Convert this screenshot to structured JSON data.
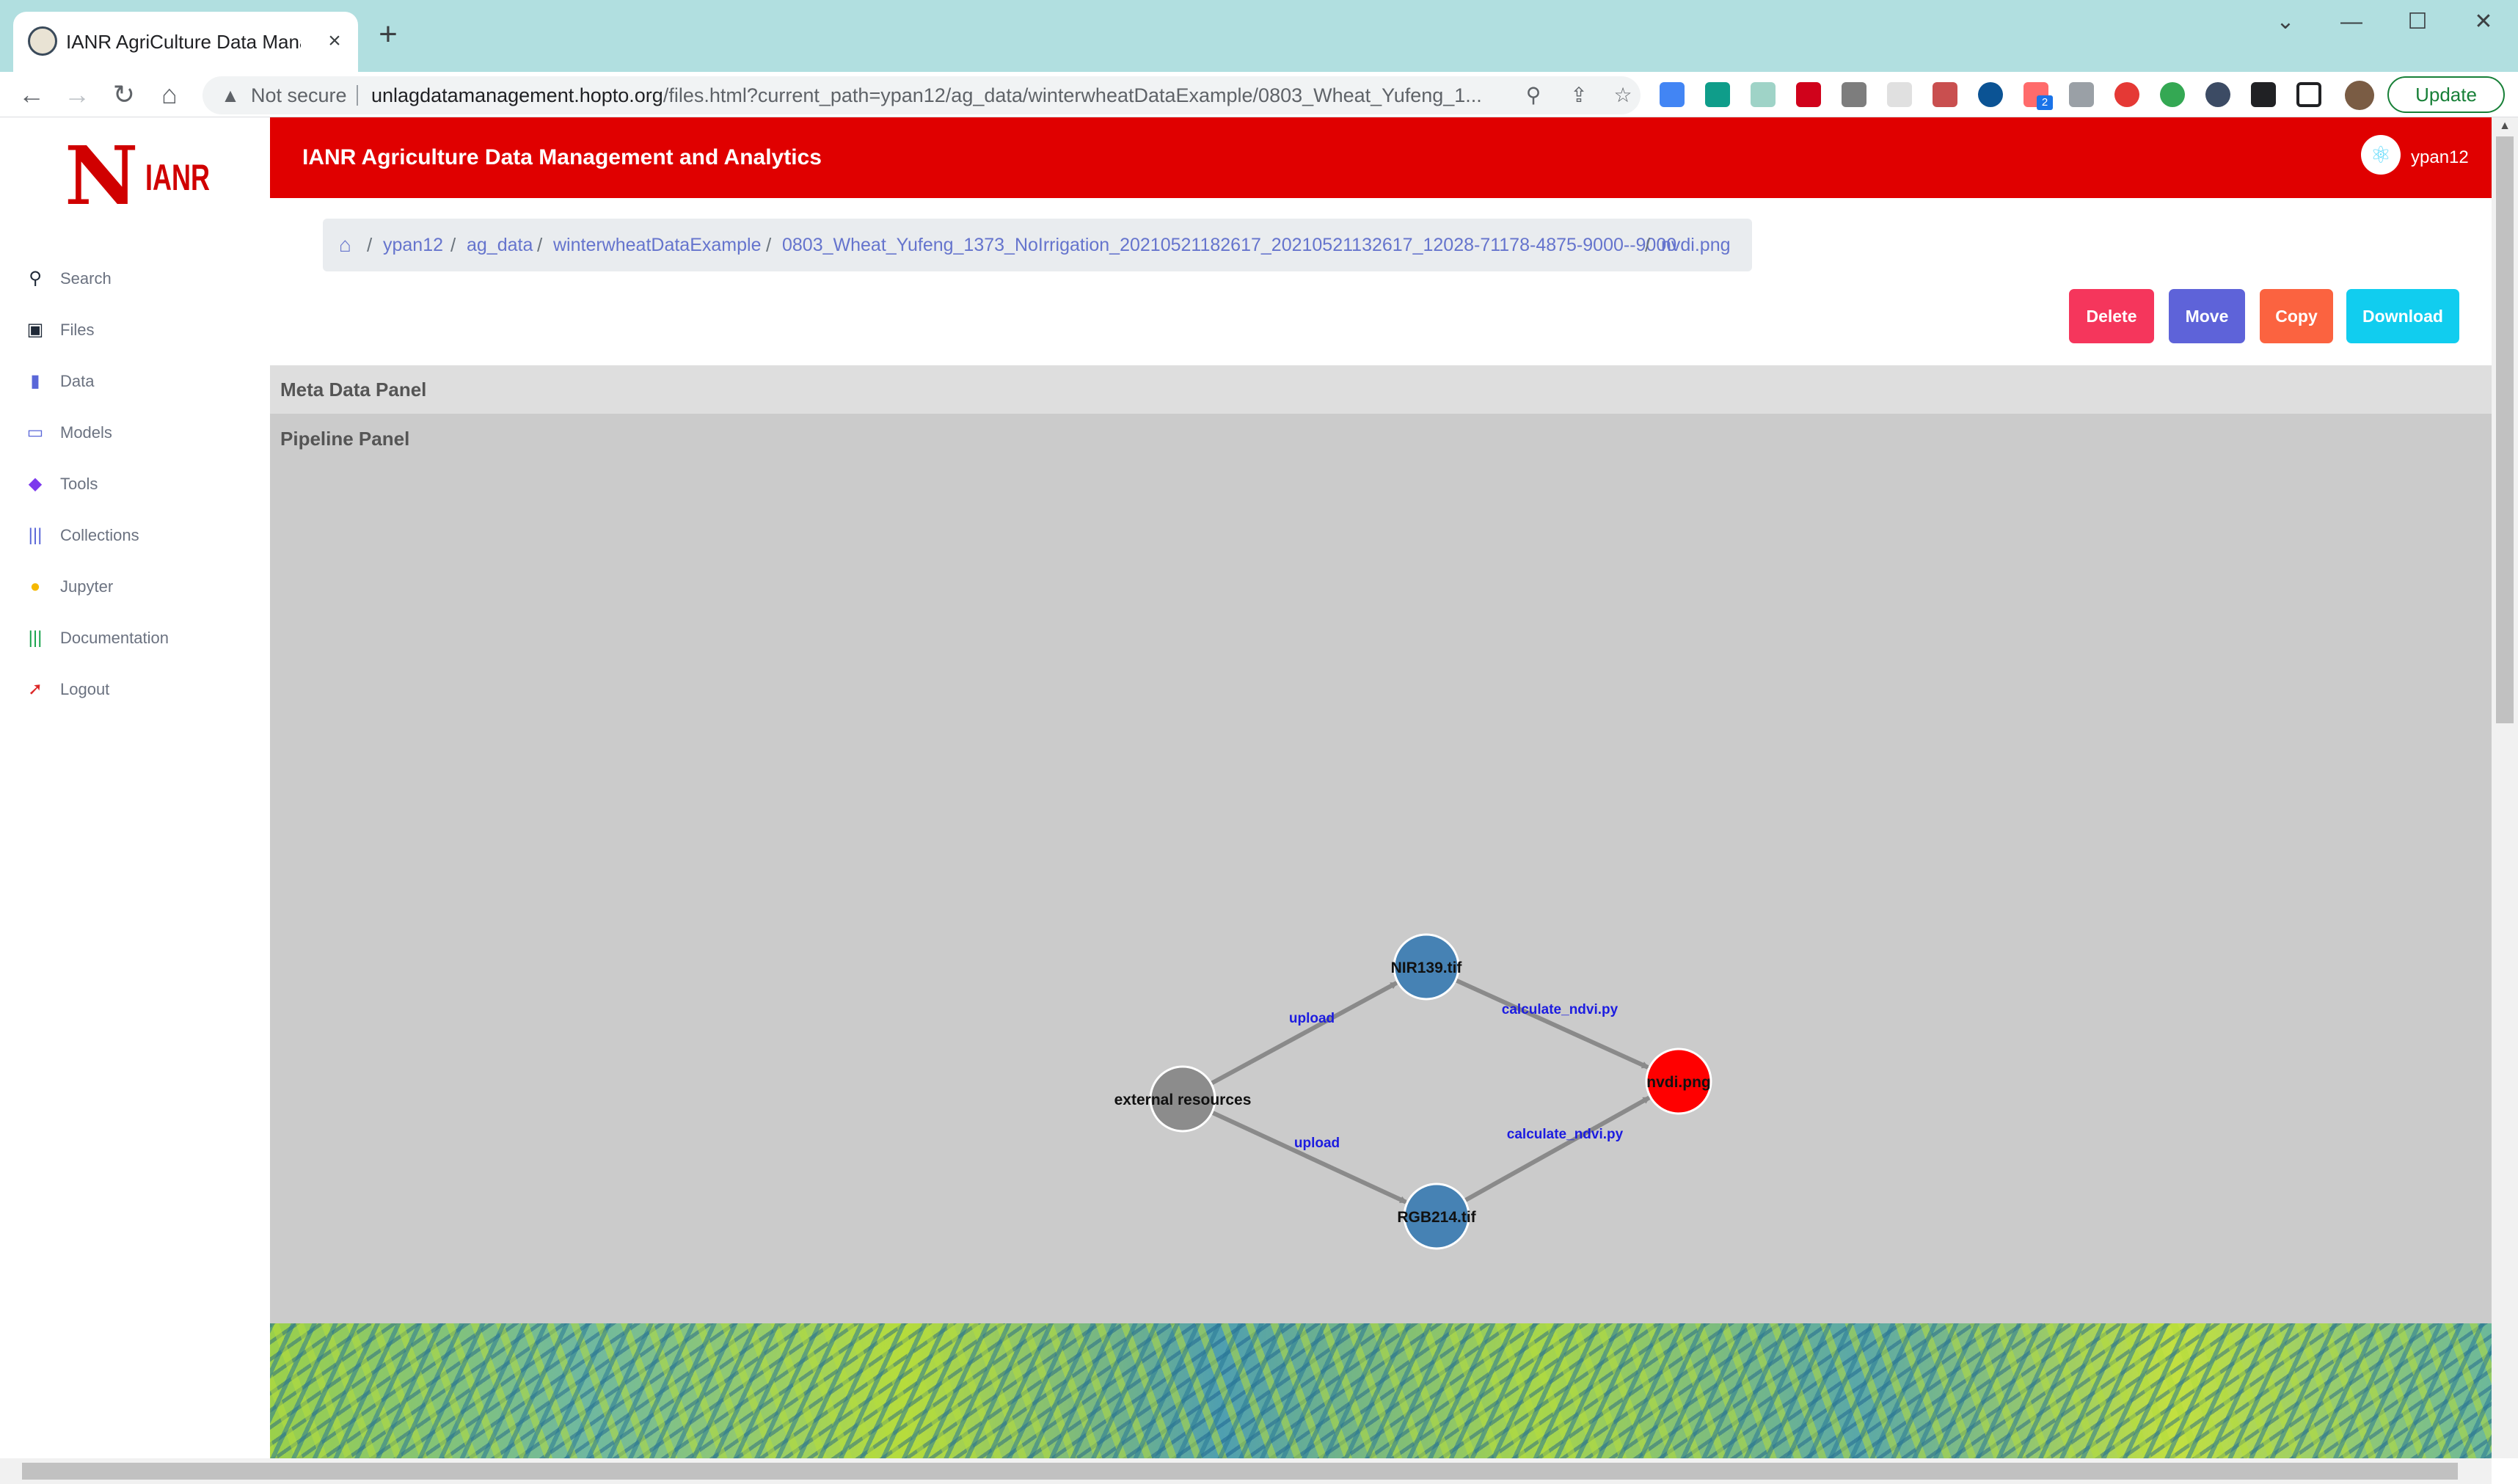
{
  "browser": {
    "tab_title": "IANR AgriCulture Data Management",
    "tab_close": "×",
    "new_tab": "+",
    "not_secure": "Not secure",
    "url_host": "unlagdatamanagement.hopto.org",
    "url_path": "/files.html?current_path=ypan12/ag_data/winterwheatDataExample/0803_Wheat_Yufeng_1...",
    "update_label": "Update",
    "extension_badge": "2"
  },
  "brand": {
    "logo_letter": "N",
    "logo_text": "IANR"
  },
  "sidebar": {
    "items": [
      {
        "label": "Search",
        "icon": "search-icon",
        "color": "#1f2937",
        "glyph": "⚲"
      },
      {
        "label": "Files",
        "icon": "briefcase-icon",
        "color": "#1f2937",
        "glyph": "▣"
      },
      {
        "label": "Data",
        "icon": "bar-chart-icon",
        "color": "#5a67d8",
        "glyph": "▮"
      },
      {
        "label": "Models",
        "icon": "laptop-icon",
        "color": "#5a67d8",
        "glyph": "▭"
      },
      {
        "label": "Tools",
        "icon": "cube-icon",
        "color": "#7c3aed",
        "glyph": "◆"
      },
      {
        "label": "Collections",
        "icon": "books-icon",
        "color": "#5a67d8",
        "glyph": "|||"
      },
      {
        "label": "Jupyter",
        "icon": "user-icon",
        "color": "#f5b800",
        "glyph": "●"
      },
      {
        "label": "Documentation",
        "icon": "library-icon",
        "color": "#16a34a",
        "glyph": "|||"
      },
      {
        "label": "Logout",
        "icon": "logout-icon",
        "color": "#dc2626",
        "glyph": "➚"
      }
    ]
  },
  "header": {
    "title": "IANR Agriculture Data Management and Analytics",
    "username": "ypan12"
  },
  "breadcrumb": [
    "ypan12",
    "ag_data",
    "winterwheatDataExample",
    "0803_Wheat_Yufeng_1373_NoIrrigation_20210521182617_20210521132617_12028-71178-4875-9000--9000",
    "nvdi.png"
  ],
  "actions": {
    "delete": "Delete",
    "move": "Move",
    "copy": "Copy",
    "download": "Download"
  },
  "colors": {
    "delete": "#f5365c",
    "move": "#5e63d9",
    "copy": "#fb6340",
    "download": "#11cdef",
    "header": "#e00000"
  },
  "panels": {
    "meta": "Meta Data Panel",
    "pipeline": "Pipeline Panel"
  },
  "pipeline": {
    "nodes": [
      {
        "id": "ext",
        "label": "external resources",
        "color": "#8c8c8c"
      },
      {
        "id": "nir",
        "label": "NIR139.tif",
        "color": "#4682b4"
      },
      {
        "id": "rgb",
        "label": "RGB214.tif",
        "color": "#4682b4"
      },
      {
        "id": "ndvi",
        "label": "nvdi.png",
        "color": "#ff0000"
      }
    ],
    "edges": [
      {
        "from": "ext",
        "to": "nir",
        "label": "upload"
      },
      {
        "from": "ext",
        "to": "rgb",
        "label": "upload"
      },
      {
        "from": "nir",
        "to": "ndvi",
        "label": "calculate_ndvi.py"
      },
      {
        "from": "rgb",
        "to": "ndvi",
        "label": "calculate_ndvi.py"
      }
    ]
  }
}
